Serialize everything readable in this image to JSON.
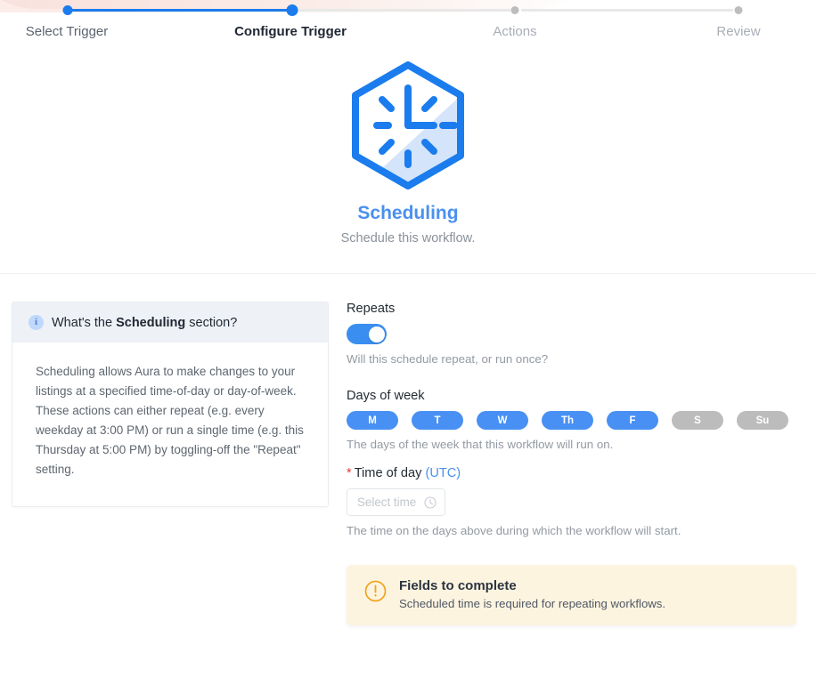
{
  "stepper": {
    "steps": [
      {
        "label": "Select Trigger",
        "state": "done"
      },
      {
        "label": "Configure Trigger",
        "state": "current"
      },
      {
        "label": "Actions",
        "state": "todo"
      },
      {
        "label": "Review",
        "state": "todo"
      }
    ]
  },
  "hero": {
    "icon": "hexagon-clock-icon",
    "title": "Scheduling",
    "subtitle": "Schedule this workflow."
  },
  "info_card": {
    "icon": "info-icon",
    "heading_prefix": "What's the ",
    "heading_bold": "Scheduling",
    "heading_suffix": " section?",
    "body": "Scheduling allows Aura to make changes to your listings at a specified time-of-day or day-of-week. These actions can either repeat (e.g. every weekday at 3:00 PM) or run a single time (e.g. this Thursday at 5:00 PM) by toggling-off the \"Repeat\" setting."
  },
  "form": {
    "repeats": {
      "label": "Repeats",
      "toggle_on": true,
      "hint": "Will this schedule repeat, or run once?"
    },
    "days_of_week": {
      "label": "Days of week",
      "hint": "The days of the week that this workflow will run on.",
      "days": [
        {
          "label": "M",
          "selected": true
        },
        {
          "label": "T",
          "selected": true
        },
        {
          "label": "W",
          "selected": true
        },
        {
          "label": "Th",
          "selected": true
        },
        {
          "label": "F",
          "selected": true
        },
        {
          "label": "S",
          "selected": false
        },
        {
          "label": "Su",
          "selected": false
        }
      ]
    },
    "time_of_day": {
      "required_marker": "*",
      "label": "Time of day ",
      "timezone": "(UTC)",
      "placeholder": "Select time",
      "value": "",
      "icon": "clock-icon",
      "hint": "The time on the days above during which the workflow will start."
    }
  },
  "warning": {
    "icon": "warning-circle-icon",
    "title": "Fields to complete",
    "message": "Scheduled time is required for repeating workflows."
  },
  "colors": {
    "accent_blue": "#1b7ced",
    "pill_blue": "#4890f3",
    "pill_gray": "#bcbcbc",
    "warning_bg": "#fdf4e0",
    "warning_icon": "#f0a41e",
    "required_red": "#e23a2e",
    "info_header_bg": "#eef1f6"
  }
}
